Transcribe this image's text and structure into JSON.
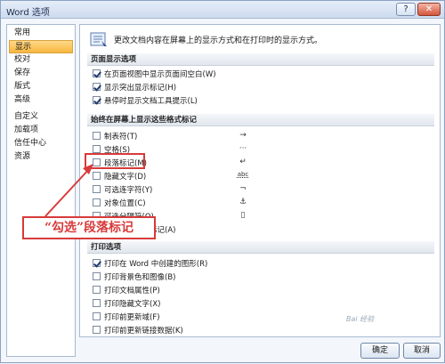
{
  "window": {
    "title": "Word 选项",
    "help_glyph": "?",
    "close_glyph": "✕"
  },
  "nav": {
    "items": [
      {
        "label": "常用"
      },
      {
        "label": "显示"
      },
      {
        "label": "校对"
      },
      {
        "label": "保存"
      },
      {
        "label": "版式"
      },
      {
        "label": "高级"
      },
      {
        "label": "自定义"
      },
      {
        "label": "加载项"
      },
      {
        "label": "信任中心"
      },
      {
        "label": "资源"
      }
    ],
    "selected": "显示"
  },
  "header": {
    "description": "更改文档内容在屏幕上的显示方式和在打印时的显示方式。",
    "icon": "display-icon"
  },
  "page_display": {
    "title": "页面显示选项",
    "options": [
      {
        "label": "在页面视图中显示页面间空白(W)",
        "checked": true
      },
      {
        "label": "显示突出显示标记(H)",
        "checked": true
      },
      {
        "label": "悬停时显示文档工具提示(L)",
        "checked": true
      }
    ]
  },
  "format_marks": {
    "title": "始终在屏幕上显示这些格式标记",
    "options": [
      {
        "label": "制表符(T)",
        "mark": "→",
        "checked": false
      },
      {
        "label": "空格(S)",
        "mark": "···",
        "checked": false
      },
      {
        "label": "段落标记(M)",
        "mark": "↵",
        "checked": false
      },
      {
        "label": "隐藏文字(D)",
        "mark": "abc",
        "checked": false
      },
      {
        "label": "可选连字符(Y)",
        "mark": "¬",
        "checked": false
      },
      {
        "label": "对象位置(C)",
        "mark": "⚓",
        "checked": false
      },
      {
        "label": "可选分隔符(O)",
        "mark": "▯",
        "checked": false
      },
      {
        "label": "显示所有格式标记(A)",
        "mark": "",
        "checked": false
      }
    ]
  },
  "print": {
    "title": "打印选项",
    "options": [
      {
        "label": "打印在 Word 中创建的图形(R)",
        "checked": true
      },
      {
        "label": "打印背景色和图像(B)",
        "checked": false
      },
      {
        "label": "打印文档属性(P)",
        "checked": false
      },
      {
        "label": "打印隐藏文字(X)",
        "checked": false
      },
      {
        "label": "打印前更新域(F)",
        "checked": false
      },
      {
        "label": "打印前更新链接数据(K)",
        "checked": false
      }
    ]
  },
  "annotation": {
    "text": "“勾选”段落标记",
    "color": "#d83a3a"
  },
  "buttons": {
    "ok": "确定",
    "cancel": "取消"
  },
  "watermark": "Bai 经验"
}
